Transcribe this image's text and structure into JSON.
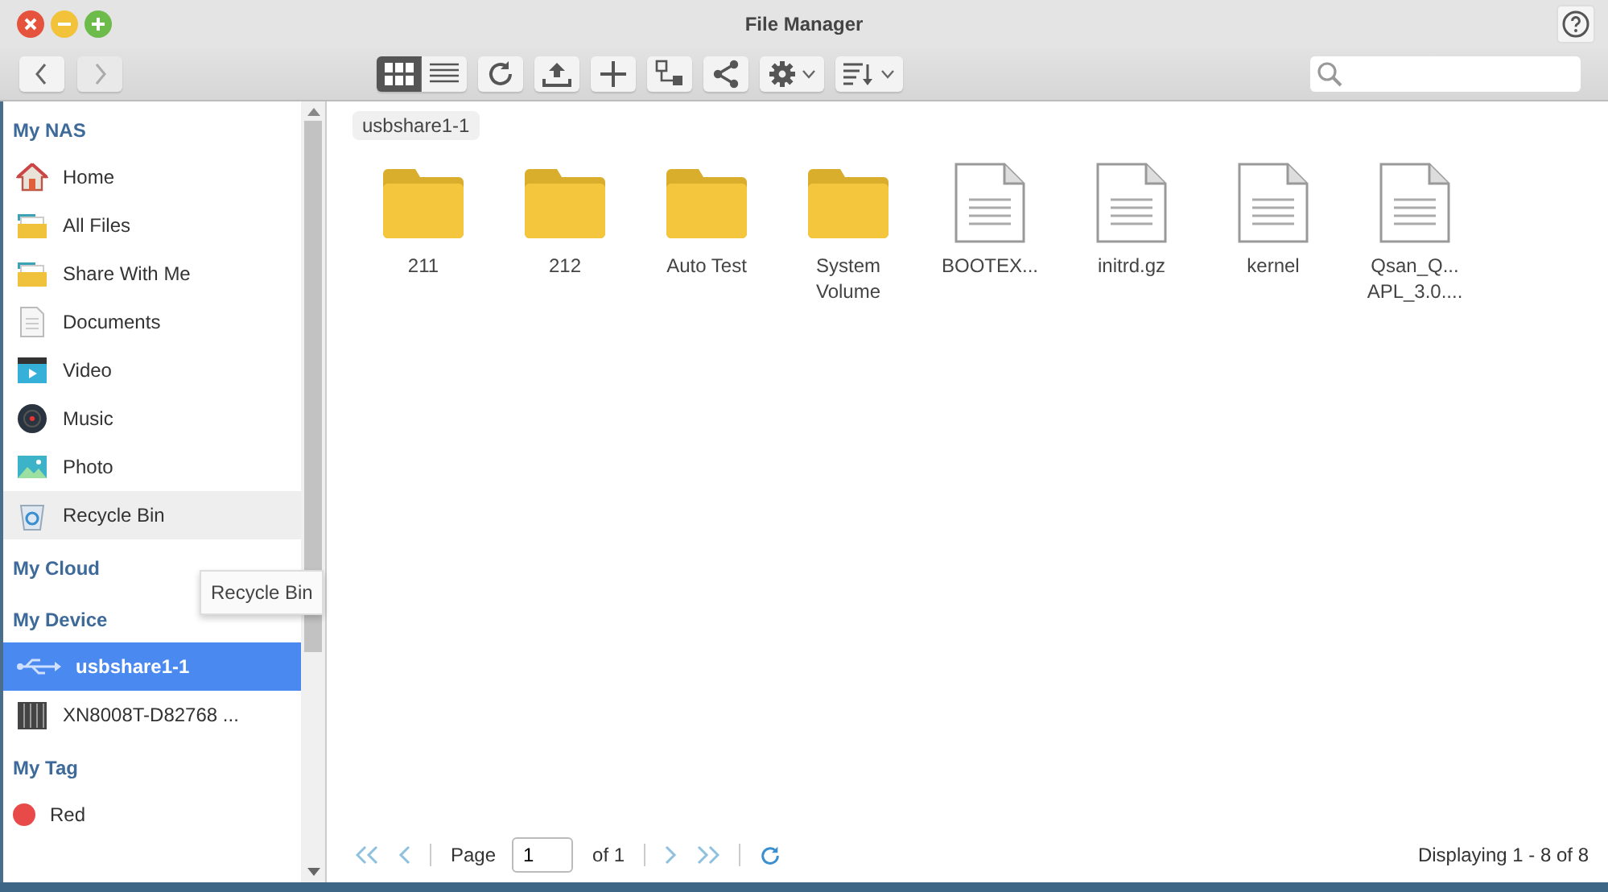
{
  "window": {
    "title": "File Manager"
  },
  "view_modes": [
    {
      "kind": "grid",
      "selected": true
    },
    {
      "kind": "list",
      "selected": false
    }
  ],
  "sidebar": {
    "sections": [
      {
        "title": "My NAS",
        "items": [
          {
            "label": "Home",
            "kind": "home",
            "selected": false,
            "hovered": false
          },
          {
            "label": "All Files",
            "kind": "folder",
            "selected": false,
            "hovered": false
          },
          {
            "label": "Share With Me",
            "kind": "folder",
            "selected": false,
            "hovered": false
          },
          {
            "label": "Documents",
            "kind": "document",
            "selected": false,
            "hovered": false
          },
          {
            "label": "Video",
            "kind": "video",
            "selected": false,
            "hovered": false
          },
          {
            "label": "Music",
            "kind": "music",
            "selected": false,
            "hovered": false
          },
          {
            "label": "Photo",
            "kind": "photo",
            "selected": false,
            "hovered": false
          },
          {
            "label": "Recycle Bin",
            "kind": "recycle",
            "selected": false,
            "hovered": true
          }
        ]
      },
      {
        "title": "My Cloud"
      },
      {
        "title": "My Device",
        "items": [
          {
            "label": "usbshare1-1",
            "kind": "usb",
            "selected": true,
            "hovered": false
          },
          {
            "label": "XN8008T-D82768 ...",
            "kind": "nas",
            "selected": false,
            "hovered": false
          }
        ]
      },
      {
        "title": "My Tag",
        "items": [
          {
            "label": "Red",
            "kind": "tag",
            "color": "#e84a4a",
            "selected": false,
            "hovered": false
          }
        ]
      }
    ]
  },
  "tooltip": {
    "text": "Recycle Bin"
  },
  "breadcrumb": "usbshare1-1",
  "files": [
    {
      "kind": "folder",
      "lines": [
        "211"
      ]
    },
    {
      "kind": "folder",
      "lines": [
        "212"
      ]
    },
    {
      "kind": "folder",
      "lines": [
        "Auto Test"
      ]
    },
    {
      "kind": "folder",
      "lines": [
        "System",
        "Volume"
      ]
    },
    {
      "kind": "file",
      "lines": [
        "BOOTEX..."
      ]
    },
    {
      "kind": "file",
      "lines": [
        "initrd.gz"
      ]
    },
    {
      "kind": "file",
      "lines": [
        "kernel"
      ]
    },
    {
      "kind": "file",
      "lines": [
        "Qsan_Q...",
        "APL_3.0...."
      ]
    }
  ],
  "pager": {
    "page_label": "Page",
    "page": "1",
    "of": "of 1",
    "status": "Displaying 1 - 8 of 8"
  }
}
